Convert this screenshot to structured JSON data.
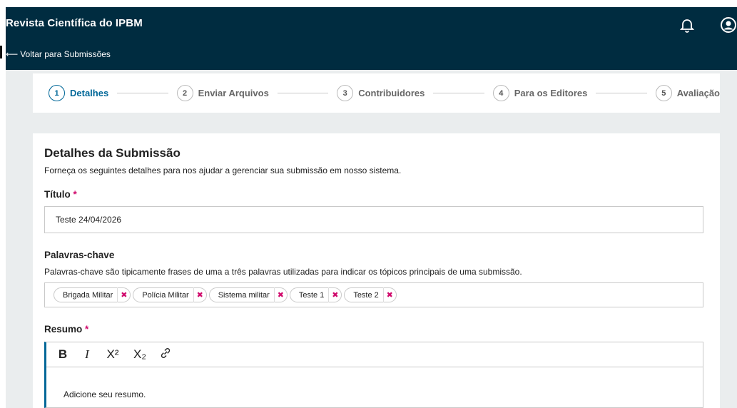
{
  "header": {
    "site_title": "Revista Científica do IPBM",
    "back_link": "Voltar para Submissões",
    "back_arrow": "⟵"
  },
  "stepper": {
    "steps": [
      {
        "num": "1",
        "label": "Detalhes",
        "active": true
      },
      {
        "num": "2",
        "label": "Enviar Arquivos",
        "active": false
      },
      {
        "num": "3",
        "label": "Contribuidores",
        "active": false
      },
      {
        "num": "4",
        "label": "Para os Editores",
        "active": false
      },
      {
        "num": "5",
        "label": "Avaliação",
        "active": false
      }
    ]
  },
  "details": {
    "title": "Detalhes da Submissão",
    "description": "Forneça os seguintes detalhes para nos ajudar a gerenciar sua submissão em nosso sistema."
  },
  "titulo": {
    "label": "Título",
    "required_mark": "*",
    "value": "Teste 24/04/2026"
  },
  "keywords": {
    "label": "Palavras-chave",
    "description": "Palavras-chave são tipicamente frases de uma a três palavras utilizadas para indicar os tópicos principais de uma submissão.",
    "chips": [
      "Brigada Militar",
      "Polícia Militar",
      "Sistema militar",
      "Teste 1",
      "Teste 2"
    ],
    "remove_glyph": "✖"
  },
  "resumo": {
    "label": "Resumo",
    "required_mark": "*",
    "toolbar": {
      "bold": "B",
      "italic": "I",
      "superscript": "X²",
      "subscript": "X₂"
    },
    "placeholder": "Adicione seu resumo."
  },
  "colors": {
    "header_bg": "#002c40",
    "accent": "#006798",
    "required": "#d00a6c",
    "page_bg": "#eaedee"
  },
  "icons": [
    "bell-icon",
    "user-icon",
    "link-icon",
    "remove-icon",
    "back-arrow-icon"
  ]
}
